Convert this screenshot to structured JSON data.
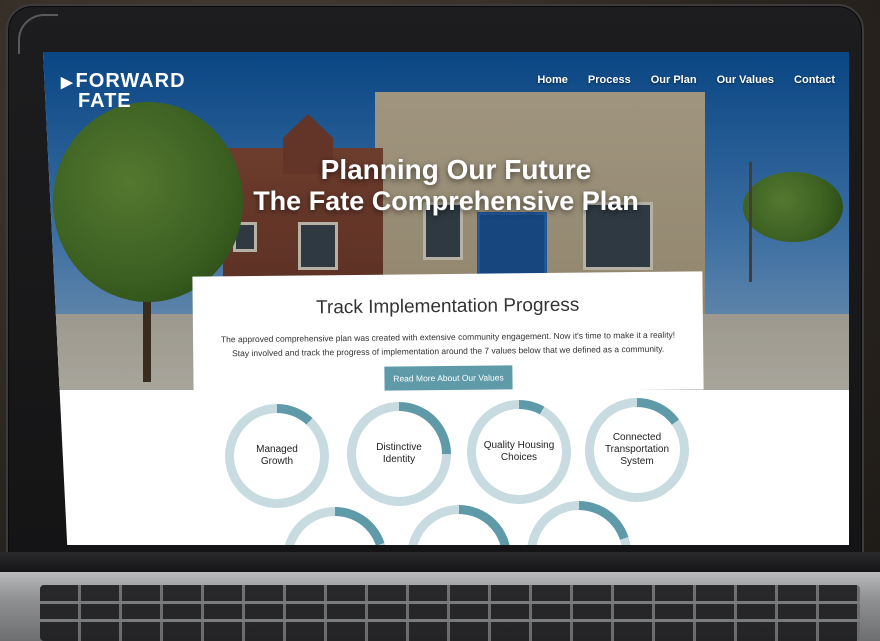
{
  "header": {
    "logo_line1": "FORWARD",
    "logo_line2": "FATE",
    "logo_arrow": "▶",
    "nav": [
      "Home",
      "Process",
      "Our Plan",
      "Our Values",
      "Contact"
    ]
  },
  "hero": {
    "title_line1": "Planning Our Future",
    "title_line2": "The Fate Comprehensive Plan"
  },
  "tracker": {
    "heading": "Track Implementation Progress",
    "body": "The approved comprehensive plan was created with extensive community engagement. Now it's time to make it a reality! Stay involved and track the progress of implementation around the 7 values below that we defined as a community.",
    "button": "Read More About Our Values"
  },
  "values": [
    {
      "label": "Managed Growth",
      "progress": 0.12
    },
    {
      "label": "Distinctive Identity",
      "progress": 0.25
    },
    {
      "label": "Quality Housing Choices",
      "progress": 0.08
    },
    {
      "label": "Connected Transportation System",
      "progress": 0.15
    },
    {
      "label": "",
      "progress": 0.2
    },
    {
      "label": "",
      "progress": 0.22
    },
    {
      "label": "",
      "progress": 0.2
    }
  ],
  "colors": {
    "accent": "#5e9aa8",
    "ring_track": "#c7dbe0",
    "ring_fill": "#5e9aa8"
  }
}
